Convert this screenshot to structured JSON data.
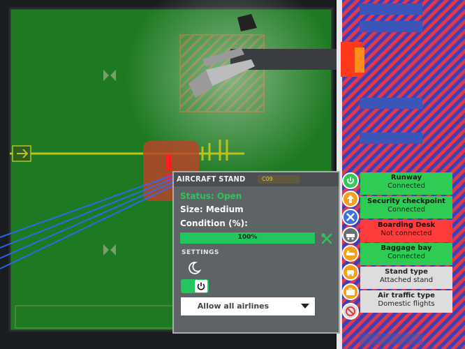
{
  "panel": {
    "title": "AIRCRAFT STAND",
    "stand_code": "C09",
    "status": "Status: Open",
    "size": "Size: Medium",
    "condition_label": "Condition (%):",
    "condition_value": 100,
    "condition_text": "100%",
    "settings_label": "SETTINGS",
    "dropdown_value": "Allow all airlines"
  },
  "requirements": [
    {
      "name": "Runway",
      "status": "Connected",
      "state": "ok",
      "icon": "power-icon"
    },
    {
      "name": "Security checkpoint",
      "status": "Connected",
      "state": "ok",
      "icon": "up-arrow-icon"
    },
    {
      "name": "Boarding Desk",
      "status": "Not connected",
      "state": "error",
      "icon": "tools-icon"
    },
    {
      "name": "Baggage bay",
      "status": "Connected",
      "state": "ok",
      "icon": "baggage-cart-icon"
    },
    {
      "name": "Stand type",
      "status": "Attached stand",
      "state": "info",
      "icon": "jet-bridge-icon"
    },
    {
      "name": "Air traffic type",
      "status": "Domestic flights",
      "state": "info",
      "icon": "car-icon"
    }
  ],
  "colors": {
    "ok": "#2ecc55",
    "error": "#ff3c3c",
    "info": "#dddddd",
    "accent": "#f59f1a"
  }
}
